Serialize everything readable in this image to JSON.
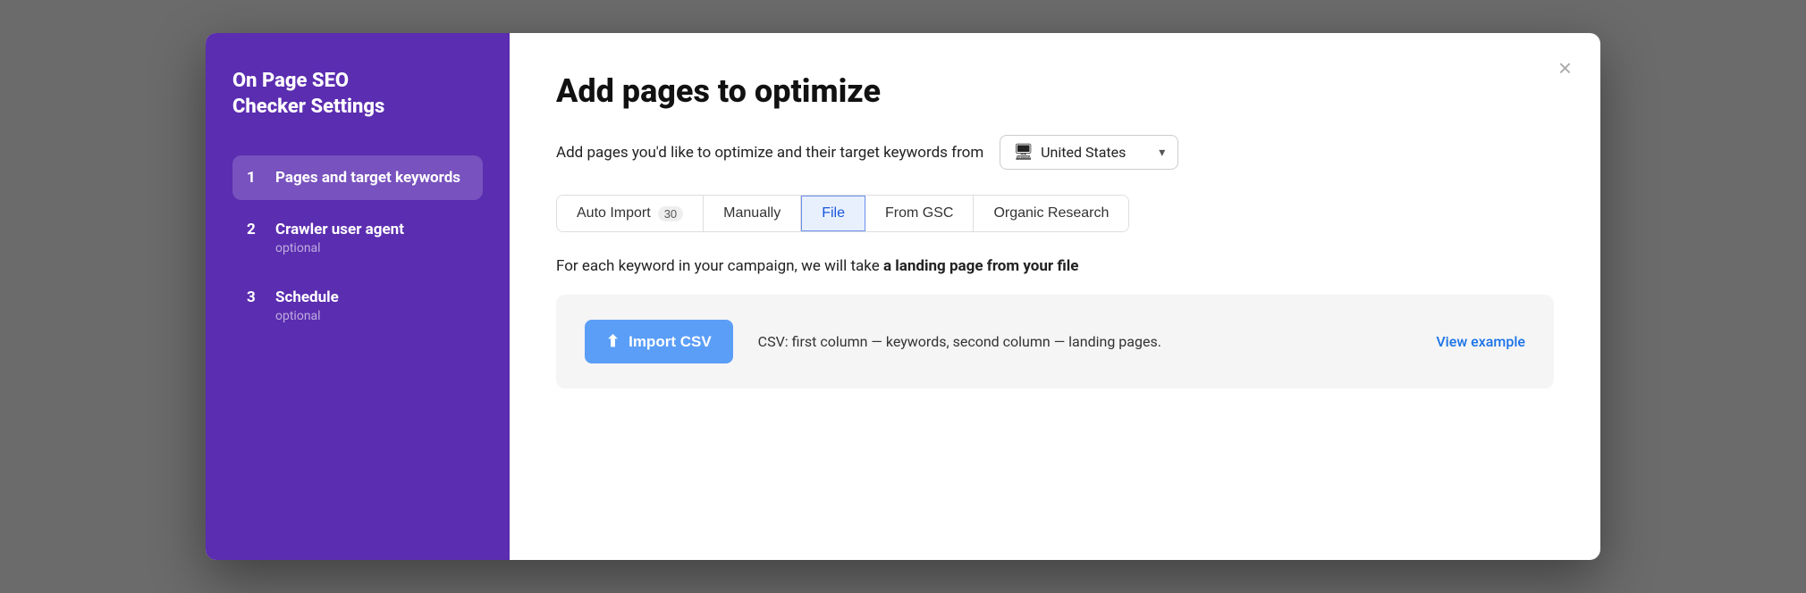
{
  "sidebar": {
    "title": "On Page SEO\nChecker Settings",
    "items": [
      {
        "number": "1",
        "label": "Pages and target keywords",
        "sublabel": "",
        "active": true
      },
      {
        "number": "2",
        "label": "Crawler user agent",
        "sublabel": "optional",
        "active": false
      },
      {
        "number": "3",
        "label": "Schedule",
        "sublabel": "optional",
        "active": false
      }
    ]
  },
  "modal": {
    "title": "Add pages to optimize",
    "subtitle": "Add pages you'd like to optimize and their target keywords from",
    "close_label": "×"
  },
  "country_select": {
    "label": "United States",
    "icon": "🖥"
  },
  "tabs": [
    {
      "label": "Auto Import",
      "badge": "30",
      "active": false
    },
    {
      "label": "Manually",
      "badge": "",
      "active": false
    },
    {
      "label": "File",
      "badge": "",
      "active": true
    },
    {
      "label": "From GSC",
      "badge": "",
      "active": false
    },
    {
      "label": "Organic Research",
      "badge": "",
      "active": false
    }
  ],
  "description": {
    "text_before": "For each keyword in your campaign, we will take ",
    "bold_text": "a landing page from your file",
    "text_after": ""
  },
  "import_box": {
    "button_label": "Import CSV",
    "description": "CSV: first column — keywords, second column — landing pages.",
    "view_example_label": "View example"
  }
}
